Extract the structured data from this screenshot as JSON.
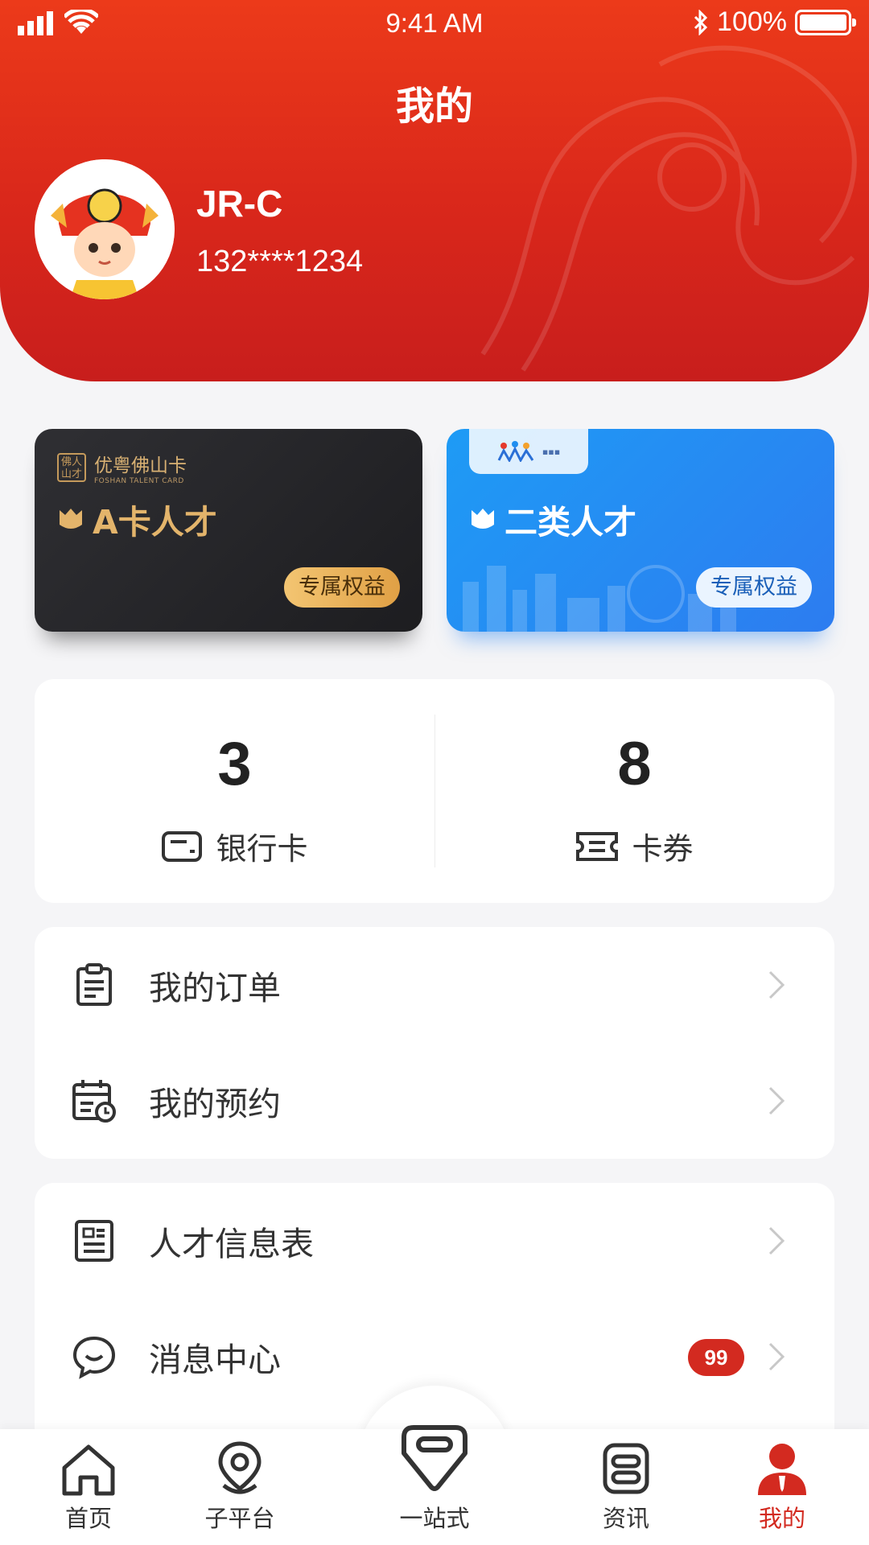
{
  "status_bar": {
    "time": "9:41 AM",
    "battery": "100%"
  },
  "header": {
    "title": "我的"
  },
  "profile": {
    "name": "JR-C",
    "phone": "132****1234"
  },
  "cards": [
    {
      "brand": "优粤佛山卡",
      "brand_sub": "FOSHAN TALENT CARD",
      "title": "A卡人才",
      "badge": "专属权益"
    },
    {
      "title": "二类人才",
      "badge": "专属权益"
    }
  ],
  "stats": [
    {
      "value": "3",
      "label": "银行卡",
      "icon": "bank-card-icon"
    },
    {
      "value": "8",
      "label": "卡券",
      "icon": "ticket-icon"
    }
  ],
  "menu": {
    "group1": [
      {
        "label": "我的订单",
        "icon": "clipboard-icon"
      },
      {
        "label": "我的预约",
        "icon": "calendar-clock-icon"
      }
    ],
    "group2": [
      {
        "label": "人才信息表",
        "icon": "document-icon"
      },
      {
        "label": "消息中心",
        "icon": "chat-bubble-icon",
        "badge": "99"
      }
    ]
  },
  "tabbar": [
    {
      "label": "首页"
    },
    {
      "label": "子平台"
    },
    {
      "label": "一站式"
    },
    {
      "label": "资讯"
    },
    {
      "label": "我的"
    }
  ],
  "colors": {
    "primary": "#d32a20",
    "header_top": "#ec3a1a",
    "gold": "#e3b46b",
    "blue": "#1e9bf5"
  }
}
